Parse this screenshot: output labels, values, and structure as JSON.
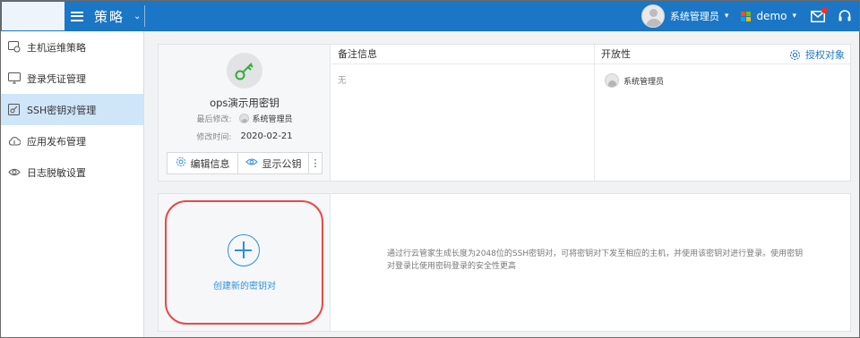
{
  "header": {
    "menu_title": "策略",
    "user_name": "系统管理员",
    "tenant": "demo"
  },
  "sidebar": {
    "items": [
      {
        "label": "主机运维策略",
        "icon": "host-policy-icon"
      },
      {
        "label": "登录凭证管理",
        "icon": "credential-icon"
      },
      {
        "label": "SSH密钥对管理",
        "icon": "ssh-key-icon",
        "active": true
      },
      {
        "label": "应用发布管理",
        "icon": "cloud-app-icon"
      },
      {
        "label": "日志脱敏设置",
        "icon": "eye-icon"
      }
    ]
  },
  "key_card": {
    "name": "ops演示用密钥",
    "last_modified_label": "最后修改:",
    "last_modified_by": "系统管理员",
    "modified_time_label": "修改时间:",
    "modified_time": "2020-02-21",
    "edit_label": "编辑信息",
    "show_pubkey_label": "显示公钥",
    "more_label": "⋮",
    "notes_header": "备注信息",
    "notes_value": "无",
    "openness_header": "开放性",
    "authorize_label": "授权对象",
    "owner": "系统管理员"
  },
  "create_card": {
    "label": "创建新的密钥对",
    "description": "通过行云管家生成长度为2048位的SSH密钥对，可将密钥对下发至相应的主机，并使用该密钥对进行登录。使用密钥对登录比使用密码登录的安全性更高"
  },
  "colors": {
    "topbar": "#1b76c5",
    "active_item": "#cfe5f8",
    "accent": "#2d90d8",
    "key_green": "#3aa93a",
    "highlight_ring": "#e64a4a"
  }
}
